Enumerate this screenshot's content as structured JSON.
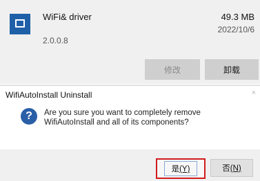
{
  "app": {
    "name": "WiFi& driver",
    "version": "2.0.0.8",
    "size": "49.3 MB",
    "date": "2022/10/6",
    "modify_label": "修改",
    "uninstall_label": "卸载",
    "icon": "app-window-icon",
    "icon_color": "#1f5fa8"
  },
  "dialog": {
    "title": "WifiAutoInstall Uninstall",
    "close_label": "×",
    "icon": "question-icon",
    "icon_glyph": "?",
    "message": "Are you sure you want to completely remove WifiAutoInstall and all of its components?",
    "yes_label": "是",
    "yes_key": "(Y)",
    "no_label": "否",
    "no_key": "(N)",
    "highlight_color": "#d01a1a"
  }
}
